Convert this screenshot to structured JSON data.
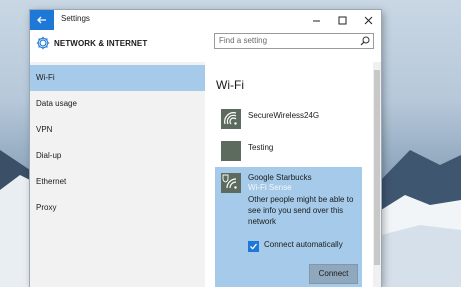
{
  "titlebar": {
    "back_icon": "arrow-left-icon",
    "title": "Settings",
    "minimize": "—",
    "maximize": "☐",
    "close": "✕"
  },
  "header": {
    "icon": "gear-icon",
    "title": "NETWORK & INTERNET",
    "search_placeholder": "Find a setting",
    "search_value": ""
  },
  "sidebar": {
    "items": [
      {
        "label": "Wi-Fi",
        "selected": true
      },
      {
        "label": "Data usage",
        "selected": false
      },
      {
        "label": "VPN",
        "selected": false
      },
      {
        "label": "Dial-up",
        "selected": false
      },
      {
        "label": "Ethernet",
        "selected": false
      },
      {
        "label": "Proxy",
        "selected": false
      }
    ]
  },
  "content": {
    "title": "Wi-Fi",
    "networks": [
      {
        "name": "SecureWireless24G",
        "icon": "wifi-secure-icon"
      },
      {
        "name": "Testing",
        "icon": "network-icon"
      }
    ],
    "selected_network": {
      "name": "Google Starbucks",
      "sense": "Wi-Fi Sense",
      "note": "Other people might be able to see info you send over this network",
      "connect_auto_label": "Connect automatically",
      "connect_auto_checked": true,
      "connect_label": "Connect",
      "icon": "wifi-shield-icon"
    }
  },
  "colors": {
    "accent": "#1e78d7",
    "selection": "#a6cbea",
    "sense_text": "#f7f7f7"
  }
}
